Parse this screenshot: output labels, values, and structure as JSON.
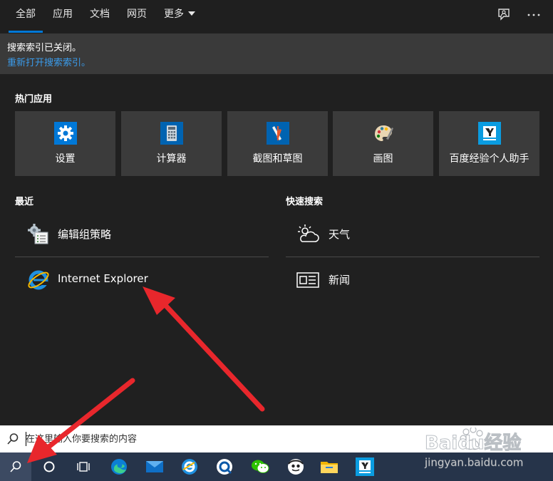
{
  "tabs": [
    {
      "label": "全部",
      "active": true
    },
    {
      "label": "应用"
    },
    {
      "label": "文档"
    },
    {
      "label": "网页"
    },
    {
      "label": "更多"
    }
  ],
  "header_icons": [
    "feedback-icon",
    "more-options-icon"
  ],
  "notice": {
    "message": "搜索索引已关闭。",
    "link": "重新打开搜索索引。"
  },
  "hot_apps": {
    "title": "热门应用",
    "items": [
      {
        "label": "设置",
        "icon": "settings-gear-icon",
        "color": "#0078d7"
      },
      {
        "label": "计算器",
        "icon": "calculator-icon",
        "color": "#0063b1"
      },
      {
        "label": "截图和草图",
        "icon": "snip-sketch-icon",
        "color": "#0063b1"
      },
      {
        "label": "画图",
        "icon": "paint-palette-icon",
        "color": "#3b3b3b"
      },
      {
        "label": "百度经验个人助手",
        "icon": "baidu-jingyan-icon",
        "color": "#0a9ce0"
      }
    ]
  },
  "recent": {
    "title": "最近",
    "items": [
      {
        "label": "编辑组策略",
        "icon": "group-policy-icon"
      },
      {
        "label": "Internet Explorer",
        "icon": "internet-explorer-icon"
      }
    ]
  },
  "quick_search": {
    "title": "快速搜索",
    "items": [
      {
        "label": "天气",
        "icon": "weather-icon"
      },
      {
        "label": "新闻",
        "icon": "news-icon"
      }
    ]
  },
  "search": {
    "placeholder": "在这里输入你要搜索的内容"
  },
  "taskbar": [
    "search-icon",
    "cortana-icon",
    "task-view-icon",
    "edge-icon",
    "mail-icon",
    "browser-icon",
    "quick-assist-icon",
    "wechat-icon",
    "app-icon",
    "file-explorer-icon",
    "baidu-jingyan-icon"
  ],
  "colors": {
    "accent": "#0078d7",
    "link": "#3a9bea",
    "arrow": "#e8272c",
    "taskbar": "#26344a"
  },
  "watermark": {
    "brand": "Baidu经验",
    "url": "jingyan.baidu.com"
  }
}
